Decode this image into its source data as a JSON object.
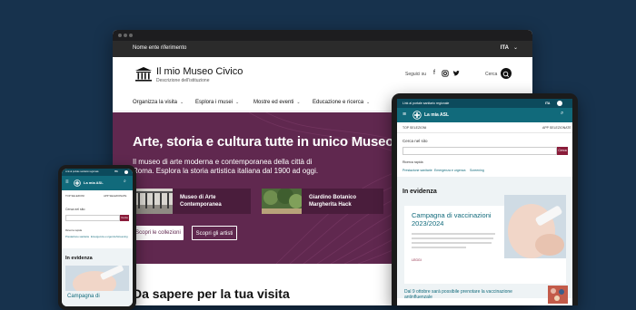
{
  "desktop": {
    "topbar": {
      "org_name": "Nome ente riferimento",
      "language": "ITA"
    },
    "header": {
      "site_title": "Il mio Museo Civico",
      "site_subtitle": "Descrizione dell'istituzione",
      "follow_label": "Seguici su",
      "social_icons": [
        "facebook-icon",
        "instagram-icon",
        "twitter-icon"
      ],
      "search_label": "Cerca"
    },
    "nav": [
      {
        "label": "Organizza la visita"
      },
      {
        "label": "Esplora i musei"
      },
      {
        "label": "Mostre ed eventi"
      },
      {
        "label": "Educazione e ricerca"
      }
    ],
    "hero": {
      "title": "Arte, storia e cultura tutte in unico Museo.",
      "description": "Il museo di arte moderna e contemporanea della città di Roma. Esplora la storia artistica italiana dal 1900 ad oggi.",
      "cards": [
        {
          "label": "Museo di Arte Contemporanea"
        },
        {
          "label": "Giardino Botanico Margherita Hack"
        }
      ],
      "primary_button": "Scopri le collezioni",
      "secondary_button": "Scopri gli artisti"
    },
    "section_title": "Da sapere per la tua visita"
  },
  "tablet": {
    "topbar_text": "Link al portale sanitario regionale",
    "language": "ITA",
    "site_name": "La mia ASL",
    "sub_left": "TOP SELEZIONI",
    "sub_right": "APP SELEZIONATE",
    "search_label": "Cerca nel sito",
    "search_button": "Cerca",
    "quick_label": "Ricerca rapida",
    "quick_links": [
      "Prestazione sanitarie",
      "Emergenza e urgenza",
      "Screening"
    ],
    "in_evidence": "In evidenza",
    "card_title": "Campagna di vaccinazioni 2023/2024",
    "card_link": "LEGGI",
    "news_text": "Dal 9 ottobre sarà possibile prenotare la vaccinazione antinfluenzale"
  },
  "phone": {
    "topbar_text": "Link al portale sanitario regionale",
    "language": "ITA",
    "site_name": "La mia ASL",
    "sub_left": "TOP SELEZIONI",
    "sub_right": "APP SELEZIONATE",
    "search_label": "Cerca nel sito",
    "search_button": "Cerca",
    "quick_label": "Ricerca rapida",
    "quick_links": [
      "Prestazione sanitarie",
      "Emergenza e urgenza",
      "Screening"
    ],
    "in_evidence": "In evidenza",
    "card_title": "Campagna di"
  },
  "colors": {
    "background": "#17324d",
    "hero_purple": "#60284f",
    "asl_teal": "#116a7b",
    "asl_dark_teal": "#0c4a5c",
    "accent_red": "#8a1c3a"
  }
}
